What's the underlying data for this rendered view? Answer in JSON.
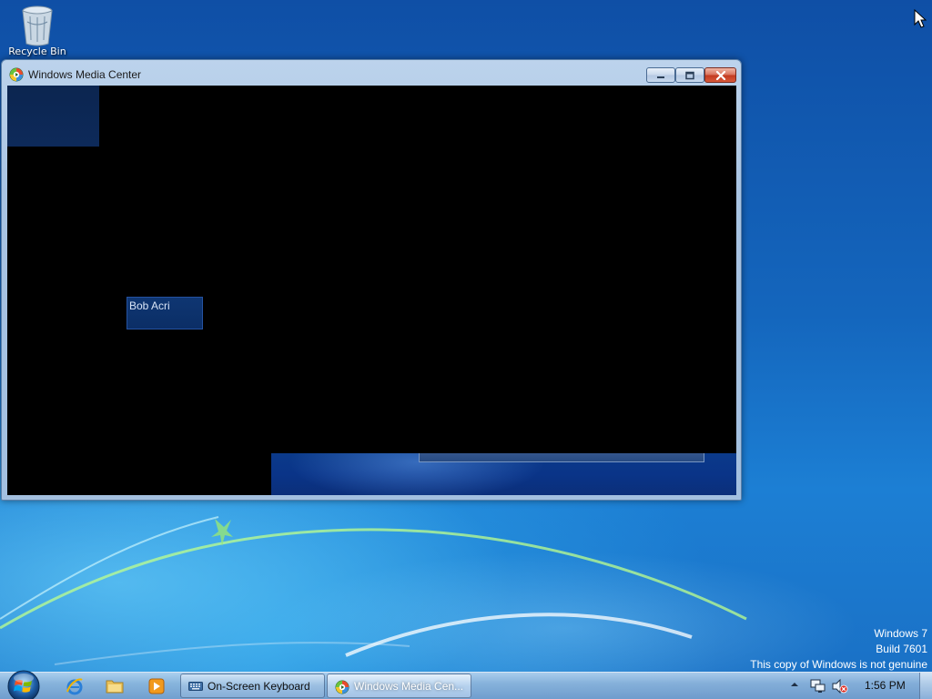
{
  "desktop": {
    "recycle_bin_label": "Recycle Bin",
    "watermark": {
      "line1": "Windows 7",
      "line2": "Build 7601",
      "line3": "This copy of Windows is not genuine"
    }
  },
  "window": {
    "title": "Windows Media Center",
    "user_tile_name": "Bob Acri",
    "controls": {
      "minimize": "minimize-icon",
      "maximize": "maximize-icon",
      "close": "close-icon"
    }
  },
  "taskbar": {
    "pinned": [
      "internet-explorer-icon",
      "windows-explorer-icon",
      "windows-media-player-icon"
    ],
    "tasks": [
      {
        "label": "On-Screen Keyboard",
        "icon": "keyboard-icon",
        "active": false
      },
      {
        "label": "Windows Media Cen...",
        "icon": "media-center-icon",
        "active": true
      }
    ],
    "clock": "1:56 PM"
  },
  "colors": {
    "desktop_blue": "#1466bd",
    "client_black": "#000000",
    "tile_blue": "#0b2e66",
    "close_red": "#c23a20"
  }
}
